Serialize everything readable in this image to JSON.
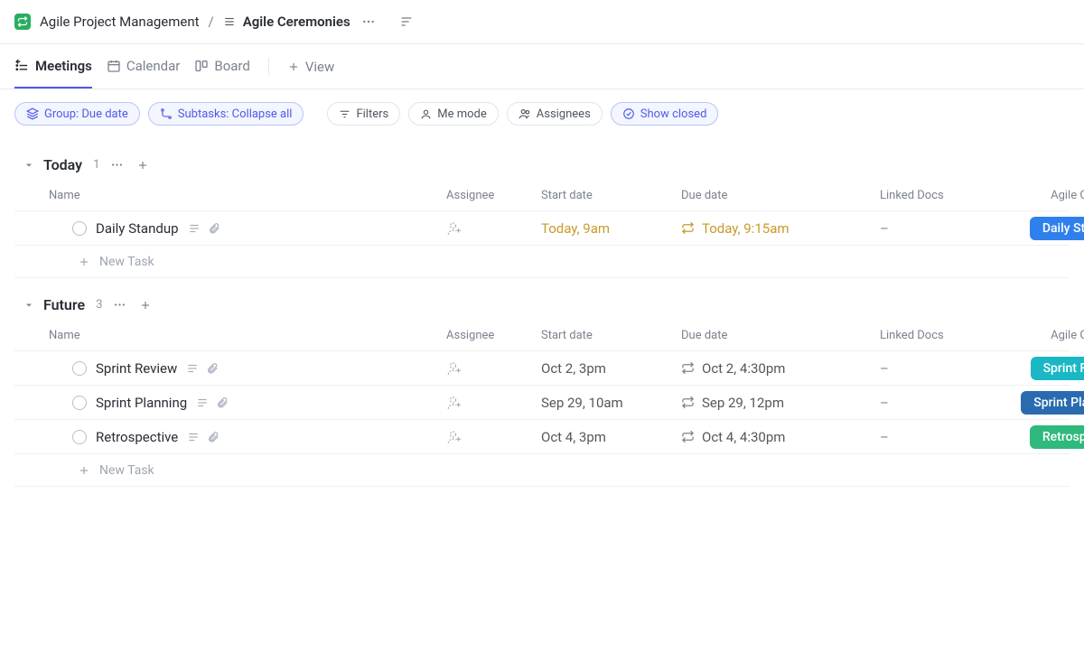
{
  "breadcrumb": {
    "space": "Agile Project Management",
    "list": "Agile Ceremonies"
  },
  "tabs": {
    "meetings": "Meetings",
    "calendar": "Calendar",
    "board": "Board",
    "add_view": "View"
  },
  "filters": {
    "group_label": "Group: Due date",
    "subtasks_label": "Subtasks: Collapse all",
    "filters_label": "Filters",
    "me_mode_label": "Me mode",
    "assignees_label": "Assignees",
    "show_closed_label": "Show closed"
  },
  "columns": {
    "name": "Name",
    "assignee": "Assignee",
    "start_date": "Start date",
    "due_date": "Due date",
    "linked_docs": "Linked Docs",
    "ceremony": "Agile Ceremony"
  },
  "groups": [
    {
      "title": "Today",
      "count": "1",
      "rows": [
        {
          "name": "Daily Standup",
          "start": "Today, 9am",
          "due": "Today, 9:15am",
          "linked": "–",
          "tag_label": "Daily Standup",
          "tag_color": "#2f80ec",
          "goldish": true
        }
      ],
      "new_task": "New Task"
    },
    {
      "title": "Future",
      "count": "3",
      "rows": [
        {
          "name": "Sprint Review",
          "start": "Oct 2, 3pm",
          "due": "Oct 2, 4:30pm",
          "linked": "–",
          "tag_label": "Sprint Review",
          "tag_color": "#1ab8c4",
          "goldish": false
        },
        {
          "name": "Sprint Planning",
          "start": "Sep 29, 10am",
          "due": "Sep 29, 12pm",
          "linked": "–",
          "tag_label": "Sprint Planning",
          "tag_color": "#2a6bb0",
          "goldish": false
        },
        {
          "name": "Retrospective",
          "start": "Oct 4, 3pm",
          "due": "Oct 4, 4:30pm",
          "linked": "–",
          "tag_label": "Retrospective",
          "tag_color": "#2fb97c",
          "goldish": false
        }
      ],
      "new_task": "New Task"
    }
  ]
}
